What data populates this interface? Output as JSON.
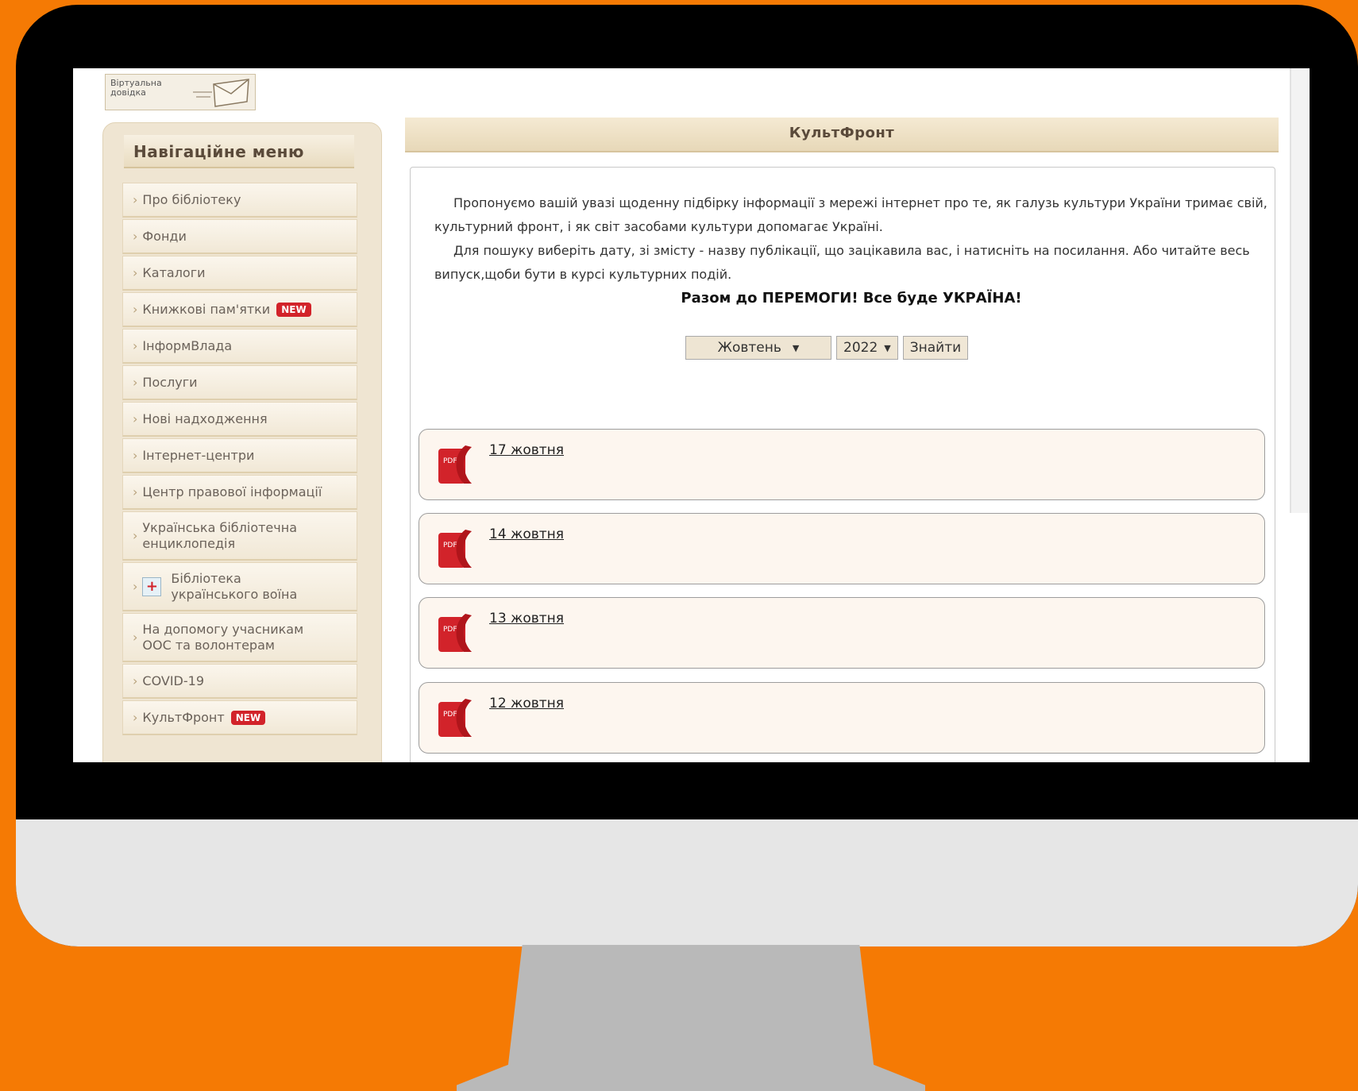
{
  "logo": {
    "line1": "Віртуальна",
    "line2": "довідка"
  },
  "sidebar": {
    "title": "Навігаційне меню",
    "items": [
      {
        "label": "Про бібліотеку"
      },
      {
        "label": "Фонди"
      },
      {
        "label": "Каталоги"
      },
      {
        "label": "Книжкові пам'ятки",
        "badge": "NEW"
      },
      {
        "label": "ІнформВлада"
      },
      {
        "label": "Послуги"
      },
      {
        "label": "Нові надходження"
      },
      {
        "label": "Інтернет-центри"
      },
      {
        "label": "Центр правової інформації"
      },
      {
        "label_line1": "Українська бібліотечна",
        "label_line2": "енциклопедія"
      },
      {
        "label_line1": "Бібліотека",
        "label_line2": "українського воїна"
      },
      {
        "label_line1": "На допомогу учасникам",
        "label_line2": "ООС та волонтерам"
      },
      {
        "label": "COVID-19"
      },
      {
        "label": "КультФронт",
        "badge": "NEW"
      }
    ]
  },
  "main": {
    "title": "КультФронт",
    "intro_p1": "Пропонуємо вашій увазі щоденну підбірку інформації з мережі інтернет про те, як галузь культури України тримає свій, культурний фронт, і як світ засобами культури допомагає Україні.",
    "intro_p2": "Для пошуку виберіть дату, зі змісту - назву публікації, що зацікавила вас, і натисніть на посилання. Або читайте весь випуск,щоби бути в курсі культурних подій.",
    "slogan": "Разом до ПЕРЕМОГИ! Все буде УКРАЇНА!",
    "filter": {
      "month": "Жовтень",
      "year": "2022",
      "button": "Знайти"
    },
    "issues": [
      "17 жовтня",
      "14 жовтня",
      "13 жовтня",
      "12 жовтня"
    ]
  },
  "colors": {
    "background": "#f57a04",
    "badge": "#d2232a",
    "pdf": "#d2232a"
  },
  "icons": {
    "pdf": "pdf-icon",
    "envelope": "envelope-icon",
    "medical": "medical-plus-icon"
  }
}
